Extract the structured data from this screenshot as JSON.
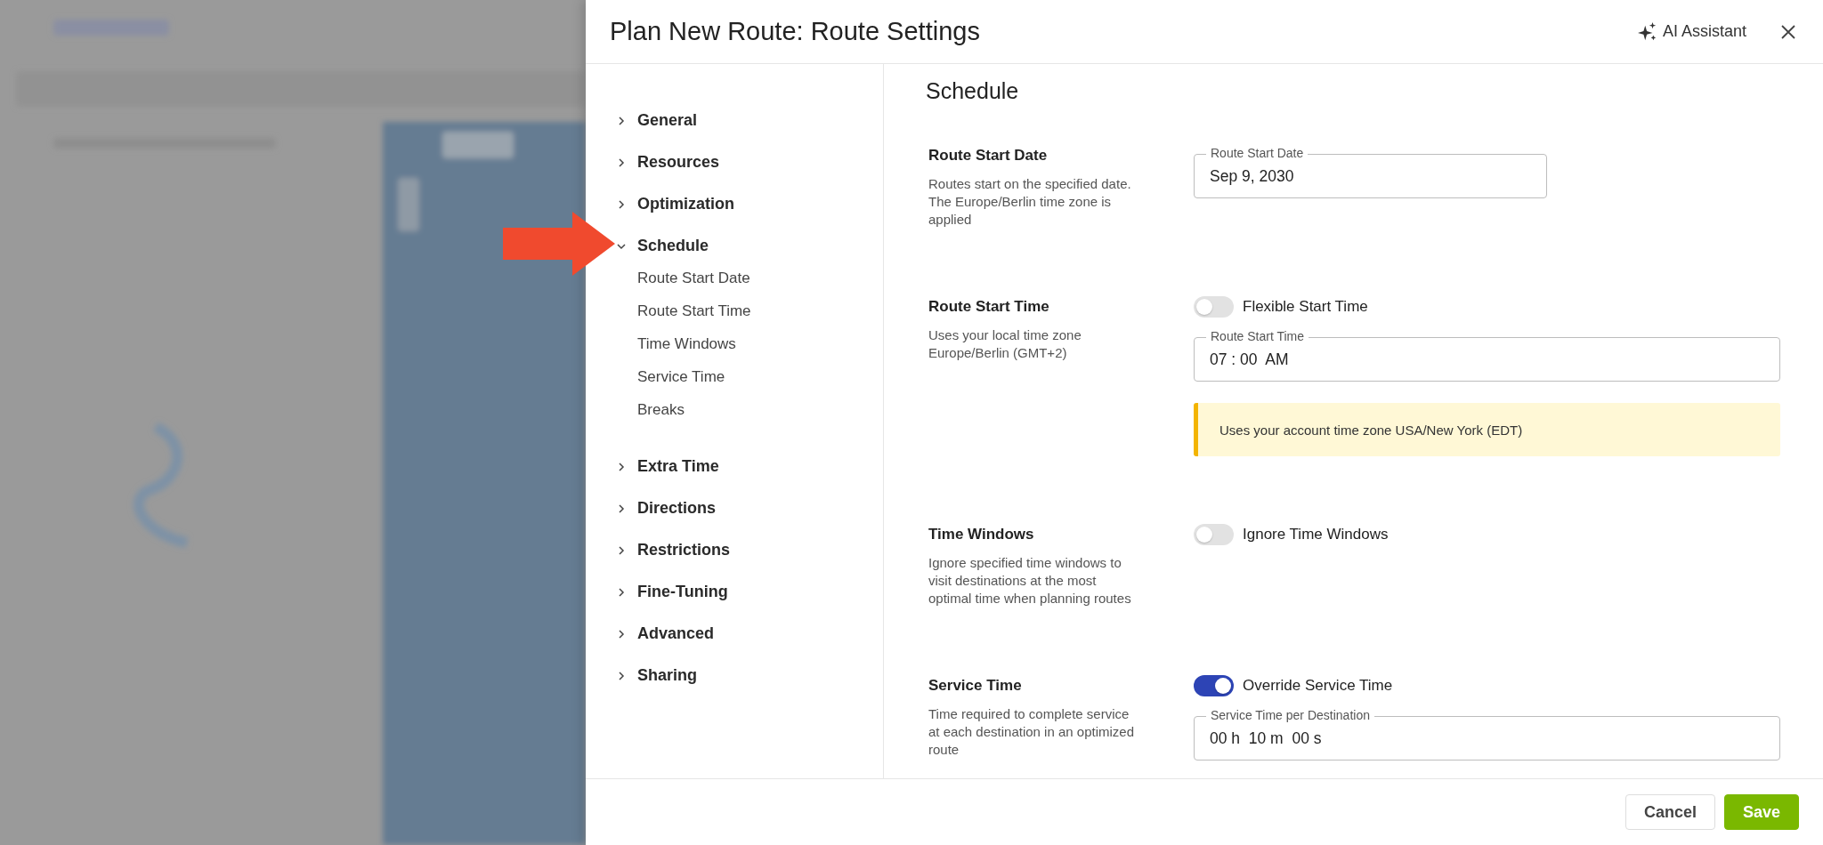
{
  "dialog": {
    "title": "Plan New Route: Route Settings",
    "assistant_label": "AI Assistant"
  },
  "nav": [
    {
      "label": "General",
      "expanded": false
    },
    {
      "label": "Resources",
      "expanded": false
    },
    {
      "label": "Optimization",
      "expanded": false
    },
    {
      "label": "Schedule",
      "expanded": true,
      "children": [
        {
          "label": "Route Start Date"
        },
        {
          "label": "Route Start Time"
        },
        {
          "label": "Time Windows"
        },
        {
          "label": "Service Time"
        },
        {
          "label": "Breaks"
        }
      ]
    },
    {
      "label": "Extra Time",
      "expanded": false
    },
    {
      "label": "Directions",
      "expanded": false
    },
    {
      "label": "Restrictions",
      "expanded": false
    },
    {
      "label": "Fine-Tuning",
      "expanded": false
    },
    {
      "label": "Advanced",
      "expanded": false
    },
    {
      "label": "Sharing",
      "expanded": false
    }
  ],
  "content": {
    "heading": "Schedule",
    "sections": [
      {
        "title": "Route Start Date",
        "description": "Routes start on the specified date. The Europe/Berlin time zone is applied",
        "field": {
          "label": "Route Start Date",
          "value": "Sep 9, 2030",
          "wide": false
        }
      },
      {
        "title": "Route Start Time",
        "description": "Uses your local time zone Europe/Berlin (GMT+2)",
        "toggle": {
          "label": "Flexible Start Time",
          "on": false
        },
        "field": {
          "label": "Route Start Time",
          "value": "07 : 00  AM",
          "wide": true
        },
        "notice": "Uses your account time zone USA/New York (EDT)"
      },
      {
        "title": "Time Windows",
        "description": "Ignore specified time windows to visit destinations at the most optimal time when planning routes",
        "toggle": {
          "label": "Ignore Time Windows",
          "on": false
        }
      },
      {
        "title": "Service Time",
        "description": "Time required to complete service at each destination in an optimized route",
        "toggle": {
          "label": "Override Service Time",
          "on": true
        },
        "field": {
          "label": "Service Time per Destination",
          "value": "00 h  10 m  00 s",
          "wide": true
        }
      }
    ]
  },
  "footer": {
    "buttons": [
      {
        "label": "Cancel",
        "kind": "secondary"
      },
      {
        "label": "Save",
        "kind": "primary"
      }
    ]
  }
}
